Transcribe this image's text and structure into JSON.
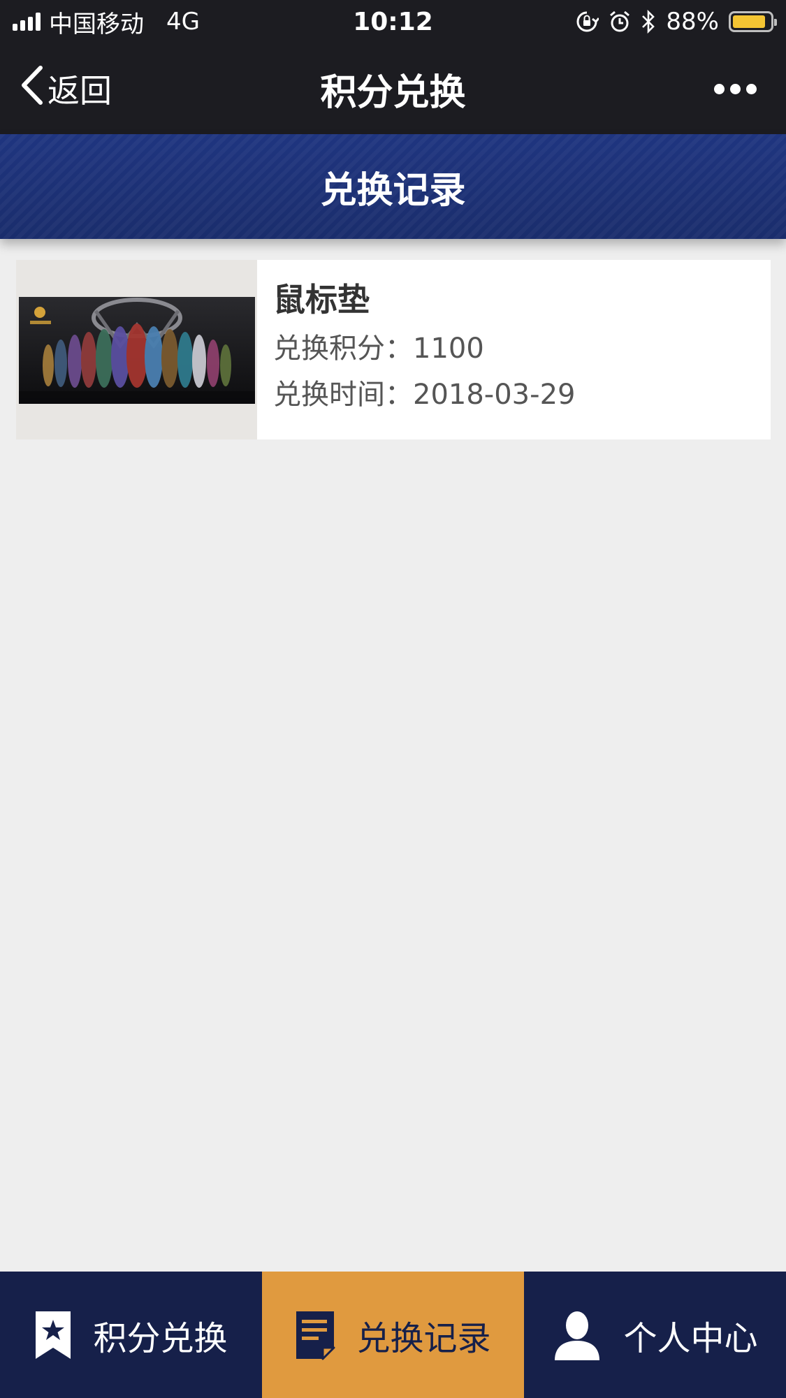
{
  "status_bar": {
    "carrier": "中国移动",
    "network": "4G",
    "time": "10:12",
    "battery_percent": "88%",
    "battery_level": 0.88,
    "icons": [
      "signal-icon",
      "rotation-lock-icon",
      "alarm-icon",
      "bluetooth-icon",
      "battery-icon"
    ]
  },
  "nav": {
    "back_label": "返回",
    "title": "积分兑换",
    "more_icon": "more-icon"
  },
  "section": {
    "title": "兑换记录"
  },
  "records": [
    {
      "name": "鼠标垫",
      "points_label": "兑换积分：",
      "points": "1100",
      "time_label": "兑换时间：",
      "time": "2018-03-29"
    }
  ],
  "tabs": [
    {
      "label": "积分兑换",
      "icon": "bookmark-star-icon",
      "active": false
    },
    {
      "label": "兑换记录",
      "icon": "document-icon",
      "active": true
    },
    {
      "label": "个人中心",
      "icon": "user-icon",
      "active": false
    }
  ],
  "colors": {
    "status_bg": "#1c1c21",
    "header_blue": "#1f3580",
    "tab_bg": "#16204a",
    "tab_active": "#e09a3f",
    "battery": "#f4c533",
    "page_bg": "#eeeeee"
  }
}
